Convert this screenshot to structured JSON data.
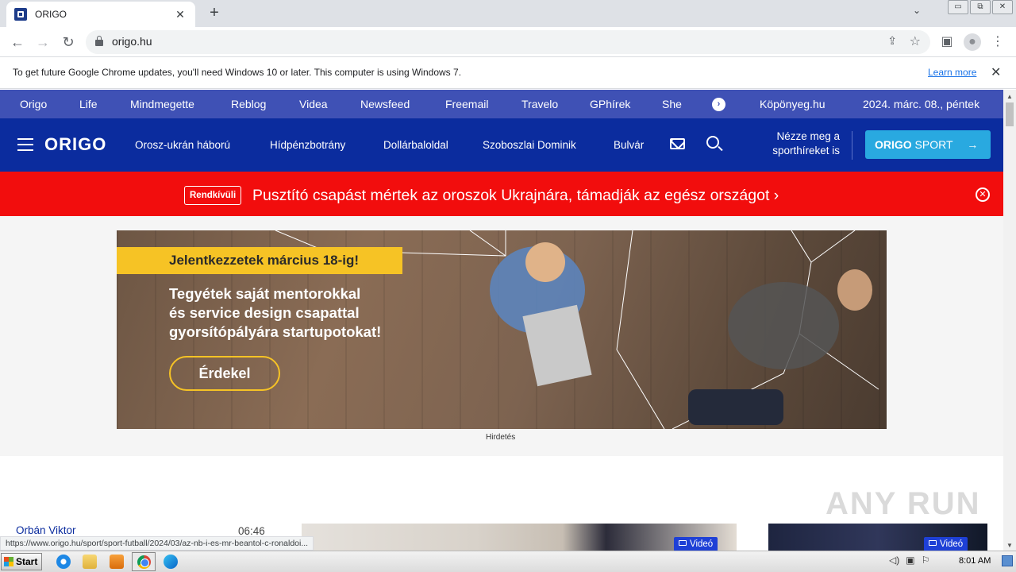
{
  "browser": {
    "tab_title": "ORIGO",
    "tab_close": "✕",
    "new_tab": "+",
    "tab_search": "⌄",
    "window_buttons": [
      "▭",
      "⧉",
      "✕"
    ],
    "url": "origo.hu",
    "nav": {
      "back": "←",
      "forward": "→",
      "reload": "↻"
    },
    "share": "⇪",
    "star": "☆",
    "side_panel": "▣",
    "profile": "●",
    "menu": "⋮"
  },
  "infobar": {
    "message": "To get future Google Chrome updates, you'll need Windows 10 or later. This computer is using Windows 7.",
    "learn_more": "Learn more",
    "close": "✕"
  },
  "site_nav": {
    "items": [
      "Origo",
      "Life",
      "Mindmegette",
      "Reblog",
      "Videa",
      "Newsfeed",
      "Freemail",
      "Travelo",
      "GPhírek",
      "She"
    ],
    "more": "›",
    "weather": "Köpönyeg.hu",
    "date": "2024. márc. 08., péntek"
  },
  "header": {
    "logo": "ORIGO",
    "links": [
      "Orosz-ukrán háború",
      "Hídpénzbotrány",
      "Dollárbaloldal",
      "Szoboszlai Dominik",
      "Bulvár"
    ],
    "sport_note_line1": "Nézze meg a",
    "sport_note_line2": "sporthíreket is",
    "sport_button_bold": "ORIGO",
    "sport_button_rest": " SPORT",
    "sport_button_arrow": "→"
  },
  "breaking": {
    "badge": "Rendkívüli",
    "headline": "Pusztító csapást mértek az oroszok Ukrajnára, támadják az egész országot",
    "chevron": "›",
    "close": "✕"
  },
  "ad": {
    "banner_tag": "Jelentkezzetek március 18-ig!",
    "line1": "Tegyétek saját mentorokkal",
    "line2": "és service design csapattal",
    "line3": "gyorsítópályára startupotokat!",
    "cta": "Érdekel",
    "label": "Hirdetés"
  },
  "news": {
    "name": "Orbán Viktor",
    "time": "06:46",
    "video_label": "Videó"
  },
  "status_url": "https://www.origo.hu/sport/sport-futball/2024/03/az-nb-i-es-mr-beantol-c-ronaldoi...",
  "watermark": "ANY RUN",
  "taskbar": {
    "start": "Start",
    "clock": "8:01 AM",
    "tray": [
      "◁)",
      "▣",
      "⚐"
    ]
  }
}
